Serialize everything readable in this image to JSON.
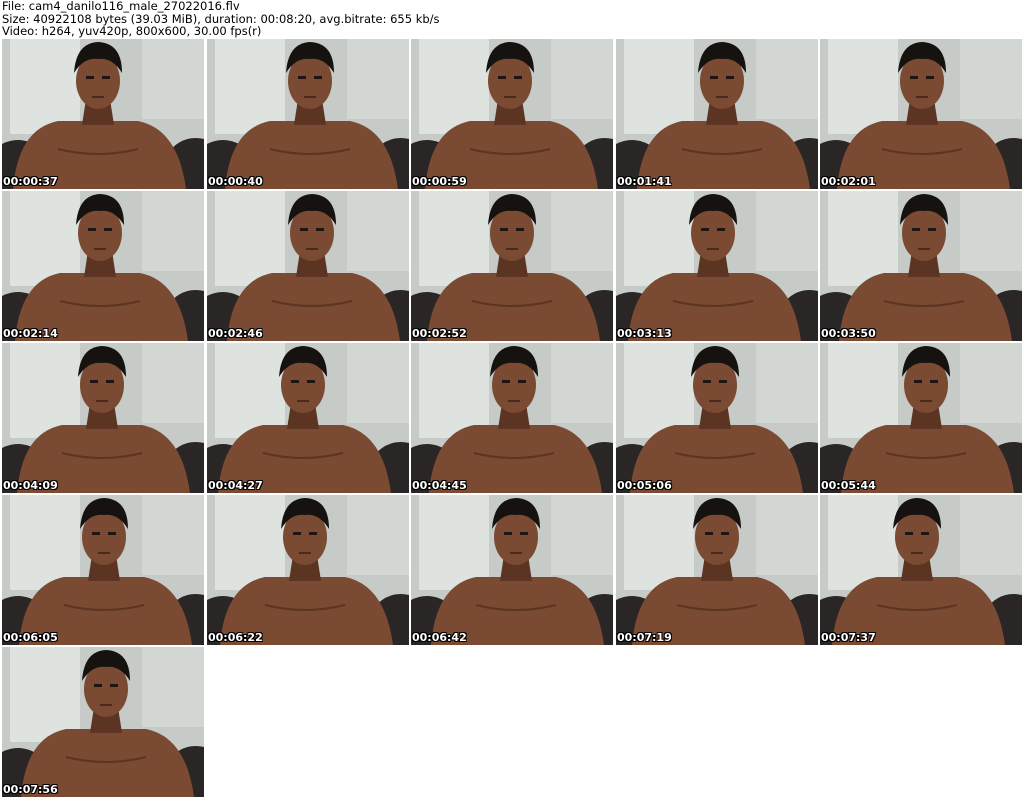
{
  "header": {
    "file_line": "File: cam4_danilo116_male_27022016.flv",
    "size_line": "Size: 40922108 bytes (39.03 MiB), duration: 00:08:20, avg.bitrate: 655 kb/s",
    "video_line": "Video: h264, yuv420p, 800x600, 30.00 fps(r)"
  },
  "thumbnails": [
    {
      "timestamp": "00:00:37"
    },
    {
      "timestamp": "00:00:40"
    },
    {
      "timestamp": "00:00:59"
    },
    {
      "timestamp": "00:01:41"
    },
    {
      "timestamp": "00:02:01"
    },
    {
      "timestamp": "00:02:14"
    },
    {
      "timestamp": "00:02:46"
    },
    {
      "timestamp": "00:02:52"
    },
    {
      "timestamp": "00:03:13"
    },
    {
      "timestamp": "00:03:50"
    },
    {
      "timestamp": "00:04:09"
    },
    {
      "timestamp": "00:04:27"
    },
    {
      "timestamp": "00:04:45"
    },
    {
      "timestamp": "00:05:06"
    },
    {
      "timestamp": "00:05:44"
    },
    {
      "timestamp": "00:06:05"
    },
    {
      "timestamp": "00:06:22"
    },
    {
      "timestamp": "00:06:42"
    },
    {
      "timestamp": "00:07:19"
    },
    {
      "timestamp": "00:07:37"
    },
    {
      "timestamp": "00:07:56"
    }
  ],
  "colors": {
    "background": "#ffffff",
    "wall": "#c6cbc8",
    "window": "#dfe3df",
    "skin": "#7a4a32",
    "skin_shadow": "#5c3422",
    "hair": "#151210",
    "couch": "#2a2626",
    "timestamp_text": "#ffffff"
  }
}
